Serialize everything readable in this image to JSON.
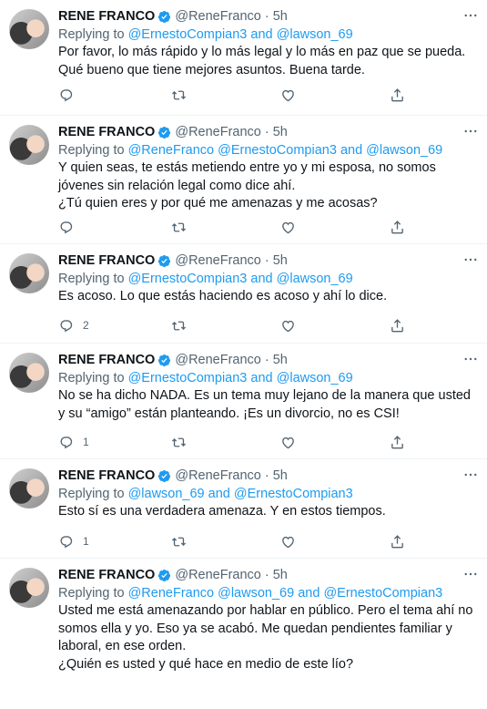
{
  "author": {
    "name": "RENE FRANCO",
    "handle": "@ReneFranco",
    "separator": "·",
    "replying_label": "Replying to"
  },
  "icons": {
    "verified": "verified-badge-icon",
    "more": "more-icon",
    "reply": "reply-icon",
    "retweet": "retweet-icon",
    "like": "like-icon",
    "share": "share-icon"
  },
  "colors": {
    "accent": "#1d9bf0",
    "muted": "#536471",
    "text": "#0f1419"
  },
  "tweets": [
    {
      "time": "5h",
      "mention1": "@ErnestoCompian3",
      "and": "and",
      "mention2": "@lawson_69",
      "lines": [
        "Por favor, lo más rápido y lo más legal y lo más en paz que se pueda. Qué bueno que tiene mejores asuntos. Buena tarde."
      ],
      "reply_count": ""
    },
    {
      "time": "5h",
      "mention1": "@ReneFranco @ErnestoCompian3",
      "and": "and",
      "mention2": "@lawson_69",
      "lines": [
        "Y quien seas, te estás metiendo entre yo y mi esposa, no somos jóvenes sin relación legal como dice ahí.",
        "¿Tú quien eres y por qué me amenazas y me acosas?"
      ],
      "reply_count": ""
    },
    {
      "time": "5h",
      "mention1": "@ErnestoCompian3",
      "and": "and",
      "mention2": "@lawson_69",
      "lines": [
        "Es acoso. Lo que estás haciendo es acoso y ahí lo dice."
      ],
      "reply_count": "2"
    },
    {
      "time": "5h",
      "mention1": "@ErnestoCompian3",
      "and": "and",
      "mention2": "@lawson_69",
      "lines": [
        "No se ha dicho NADA. Es un tema muy lejano de la manera que usted y su “amigo” están  planteando. ¡Es un divorcio, no es CSI!"
      ],
      "reply_count": "1"
    },
    {
      "time": "5h",
      "mention1": "@lawson_69",
      "and": "and",
      "mention2": "@ErnestoCompian3",
      "lines": [
        "Esto sí es una verdadera amenaza. Y en estos tiempos."
      ],
      "reply_count": "1"
    },
    {
      "time": "5h",
      "mention1": "@ReneFranco @lawson_69",
      "and": "and",
      "mention2": "@ErnestoCompian3",
      "lines": [
        "Usted me está amenazando por hablar en público. Pero el tema ahí no somos ella y yo.  Eso ya se acabó. Me quedan pendientes familiar y laboral, en ese orden.",
        "¿Quién es usted y qué hace en medio de este lío?"
      ],
      "reply_count": ""
    }
  ]
}
